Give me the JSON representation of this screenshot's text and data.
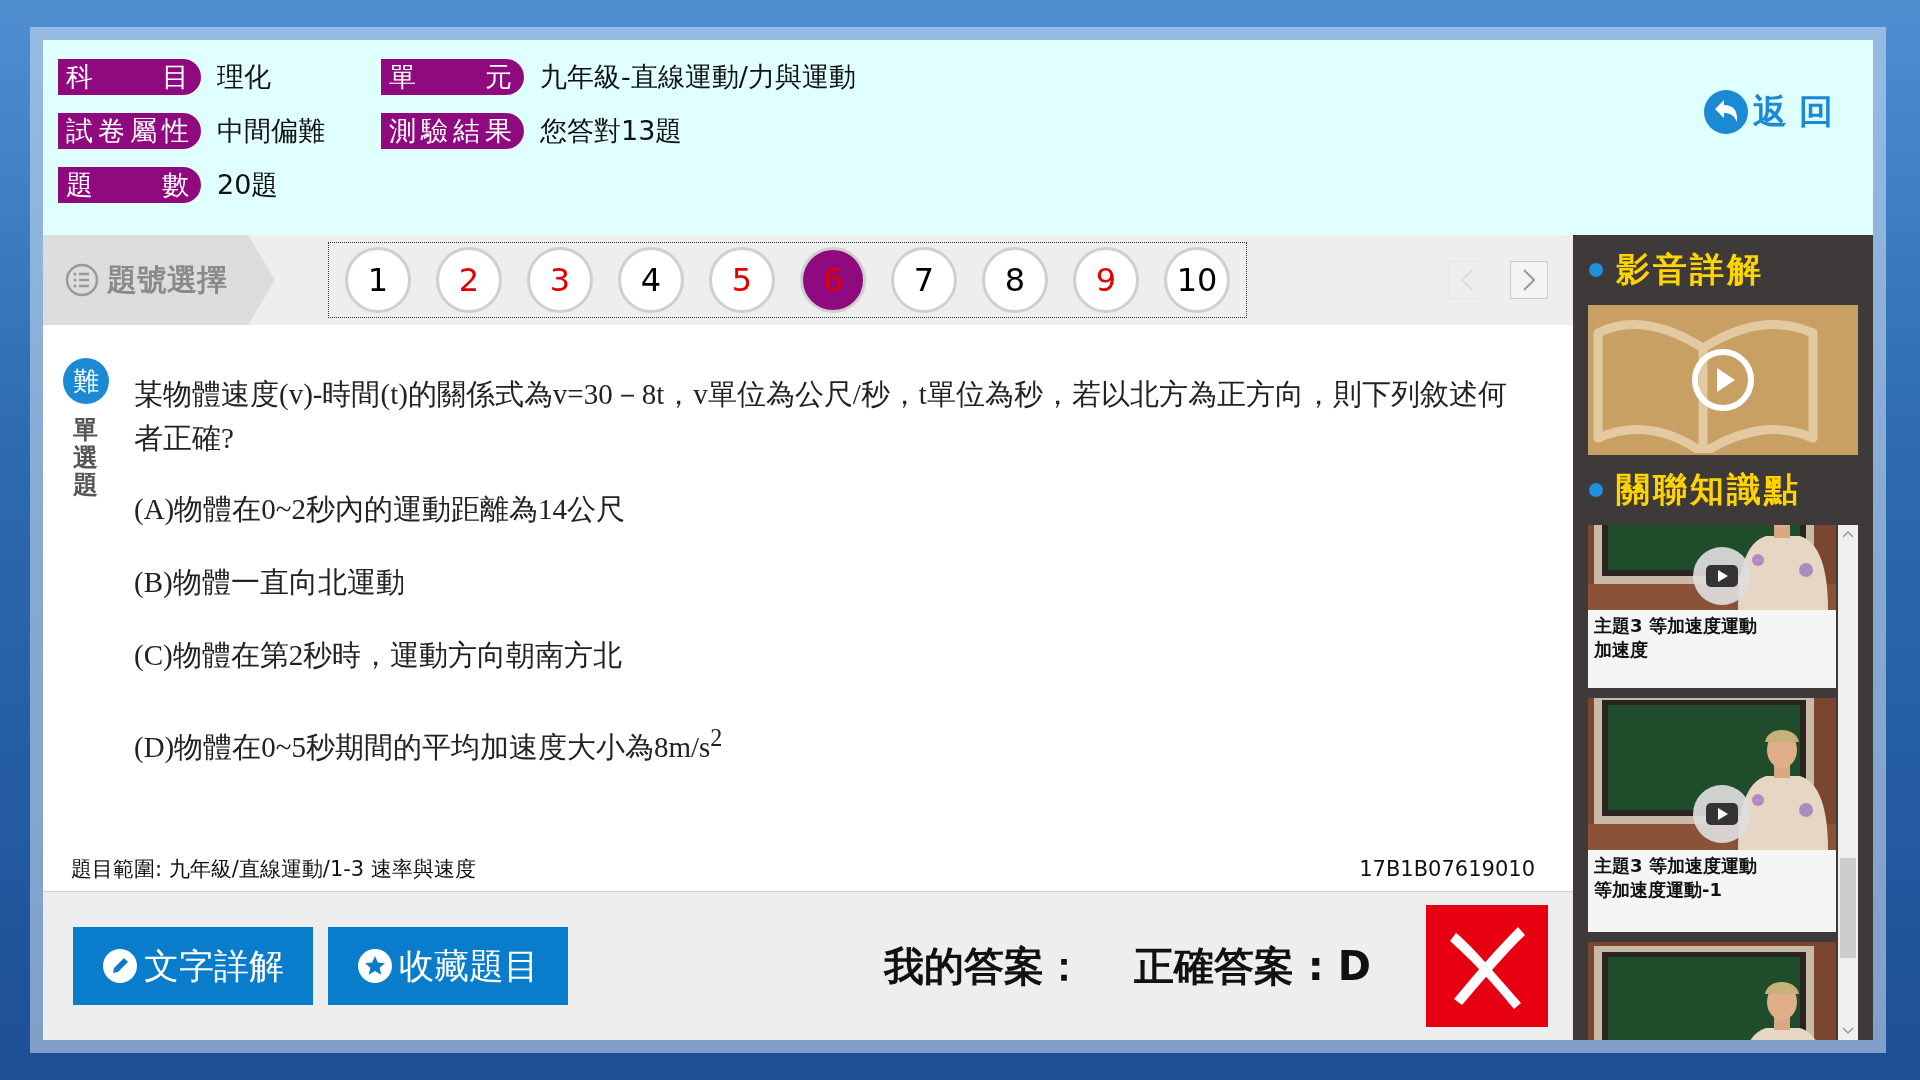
{
  "header": {
    "fields": [
      {
        "label": "科目",
        "value": "理化"
      },
      {
        "label": "單元",
        "value": "九年級-直線運動/力與運動"
      },
      {
        "label": "試卷屬性",
        "value": "中間偏難"
      },
      {
        "label": "測驗結果",
        "value": "您答對13題"
      },
      {
        "label": "題數",
        "value": "20題"
      }
    ],
    "back_button": "返 回"
  },
  "nav": {
    "label": "題號選擇",
    "numbers": [
      {
        "text": "1",
        "correct": true,
        "selected": false
      },
      {
        "text": "2",
        "correct": false,
        "selected": false
      },
      {
        "text": "3",
        "correct": false,
        "selected": false
      },
      {
        "text": "4",
        "correct": true,
        "selected": false
      },
      {
        "text": "5",
        "correct": false,
        "selected": false
      },
      {
        "text": "6",
        "correct": false,
        "selected": true
      },
      {
        "text": "7",
        "correct": true,
        "selected": false
      },
      {
        "text": "8",
        "correct": true,
        "selected": false
      },
      {
        "text": "9",
        "correct": false,
        "selected": false
      },
      {
        "text": "10",
        "correct": true,
        "selected": false
      }
    ],
    "pager": [
      {
        "kind": "prev",
        "disabled": true
      },
      {
        "kind": "next",
        "disabled": false
      }
    ]
  },
  "question": {
    "difficulty": "難",
    "type": "單選題",
    "stem": "某物體速度(v)-時間(t)的關係式為v=30－8t，v單位為公尺/秒，t單位為秒，若以北方為正方向，則下列敘述何者正確?",
    "options": [
      "(A)物體在0~2秒內的運動距離為14公尺",
      "(B)物體一直向北運動",
      "(C)物體在第2秒時，運動方向朝南方北",
      "(D)物體在0~5秒期間的平均加速度大小為8m/s$^{2}$"
    ],
    "scope": "題目範圍: 九年級/直線運動/1-3 速率與速度",
    "code": "17B1B07619010"
  },
  "actions": {
    "buttons": [
      {
        "kind": "explain",
        "label": "文字詳解"
      },
      {
        "kind": "bookmark",
        "label": "收藏題目"
      }
    ],
    "my_answer": "我的答案：",
    "correct_answer": "正確答案 : D",
    "correct": false
  },
  "side": {
    "video_title": "影音詳解",
    "related_title": "關聯知識點",
    "videos": [
      {
        "kind": "card",
        "lines": [
          "主題3 等加速度運動",
          "加速度"
        ]
      },
      {
        "kind": "card",
        "lines": [
          "主題3 等加速度運動",
          "等加速度運動-1"
        ]
      },
      {
        "kind": "cut"
      }
    ]
  }
}
